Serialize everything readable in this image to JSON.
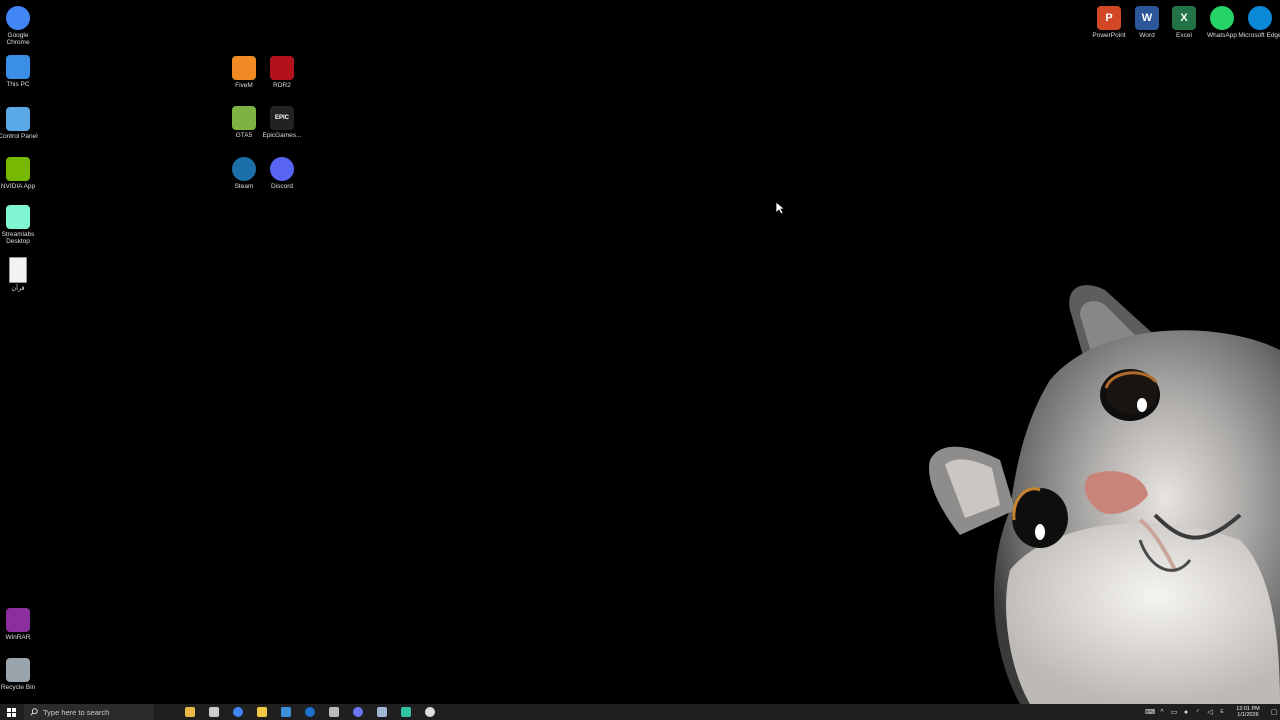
{
  "desktop": {
    "left_column": [
      {
        "label": "Google Chrome",
        "icon": "chrome-icon",
        "color": "#4285F4"
      },
      {
        "label": "This PC",
        "icon": "computer-icon",
        "color": "#3a8ee6"
      },
      {
        "label": "Control Panel",
        "icon": "control-panel-icon",
        "color": "#5aa8e6"
      },
      {
        "label": "NVIDIA App",
        "icon": "nvidia-icon",
        "color": "#76b900"
      },
      {
        "label": "Streamlabs Desktop",
        "icon": "streamlabs-icon",
        "color": "#80f5d2"
      },
      {
        "label": "قرآن",
        "icon": "document-icon",
        "color": "#f2f2f2"
      }
    ],
    "bottom_left": [
      {
        "label": "WinRAR",
        "icon": "winrar-icon",
        "color": "#8b2fa0"
      },
      {
        "label": "Recycle Bin",
        "icon": "recycle-bin-icon",
        "color": "#9aa4ad"
      }
    ],
    "games_grid": [
      {
        "label": "FiveM",
        "icon": "fivem-icon",
        "color": "#f08a24"
      },
      {
        "label": "RDR2",
        "icon": "rdr2-icon",
        "color": "#b3121d"
      },
      {
        "label": "GTA5",
        "icon": "gta5-icon",
        "color": "#7cb342"
      },
      {
        "label": "EpicGames...",
        "icon": "epic-games-icon",
        "color": "#222222",
        "glyph_text": "EPIC"
      },
      {
        "label": "Steam",
        "icon": "steam-icon",
        "color": "#1b6fa8"
      },
      {
        "label": "Discord",
        "icon": "discord-icon",
        "color": "#5865F2"
      }
    ],
    "top_right": [
      {
        "label": "PowerPoint",
        "icon": "powerpoint-icon",
        "color": "#d24726",
        "glyph_text": "P"
      },
      {
        "label": "Word",
        "icon": "word-icon",
        "color": "#2b579a",
        "glyph_text": "W"
      },
      {
        "label": "Excel",
        "icon": "excel-icon",
        "color": "#217346",
        "glyph_text": "X"
      },
      {
        "label": "WhatsApp",
        "icon": "whatsapp-icon",
        "color": "#25D366"
      },
      {
        "label": "Microsoft Edge",
        "icon": "edge-icon",
        "color": "#0c88d8"
      }
    ]
  },
  "taskbar": {
    "search_placeholder": "Type here to search",
    "apps": [
      {
        "name": "file-explorer-yellow",
        "color": "#e8b84a"
      },
      {
        "name": "task-view",
        "color": "#cccccc"
      },
      {
        "name": "chrome",
        "color": "#4285F4"
      },
      {
        "name": "file-explorer",
        "color": "#f2c744"
      },
      {
        "name": "store",
        "color": "#3b8fd9"
      },
      {
        "name": "outlook",
        "color": "#1e6fd0"
      },
      {
        "name": "shield",
        "color": "#bbbbbb"
      },
      {
        "name": "discord",
        "color": "#6b76f5"
      },
      {
        "name": "steam",
        "color": "#9fb7d0"
      },
      {
        "name": "streamlabs",
        "color": "#31c3a2"
      },
      {
        "name": "obs-loading",
        "color": "#dddddd"
      }
    ],
    "clock": {
      "time": "12:01 PM",
      "date": "1/1/2026"
    }
  },
  "colors": {
    "taskbar_bg": "#1f1f1f",
    "desktop_bg": "#000000"
  }
}
